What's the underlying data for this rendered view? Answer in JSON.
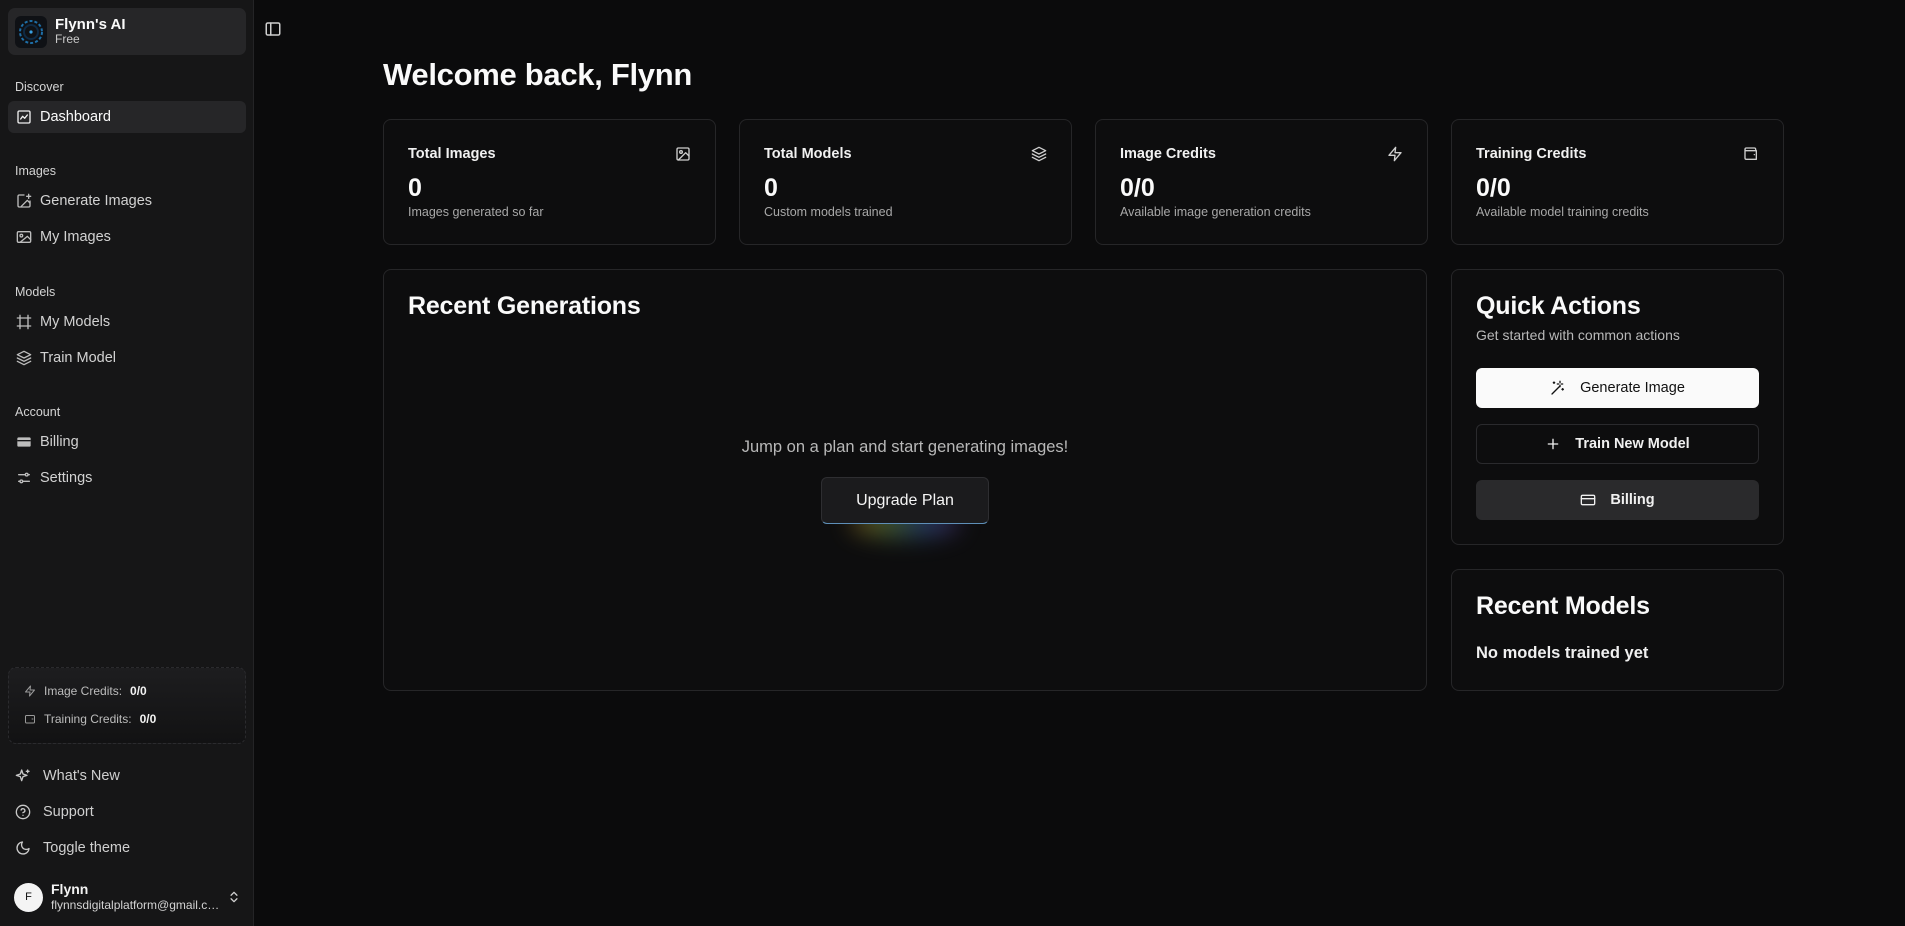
{
  "app": {
    "name": "Flynn's AI",
    "plan": "Free"
  },
  "sidebar": {
    "groups": [
      {
        "label": "Discover",
        "items": [
          {
            "label": "Dashboard",
            "icon": "dashboard-icon",
            "active": true
          }
        ]
      },
      {
        "label": "Images",
        "items": [
          {
            "label": "Generate Images",
            "icon": "image-plus-icon"
          },
          {
            "label": "My Images",
            "icon": "images-icon"
          }
        ]
      },
      {
        "label": "Models",
        "items": [
          {
            "label": "My Models",
            "icon": "frame-icon"
          },
          {
            "label": "Train Model",
            "icon": "layers-icon"
          }
        ]
      },
      {
        "label": "Account",
        "items": [
          {
            "label": "Billing",
            "icon": "credit-card-icon"
          },
          {
            "label": "Settings",
            "icon": "sliders-icon"
          }
        ]
      }
    ],
    "credits": {
      "image_label": "Image Credits:",
      "image_value": "0/0",
      "training_label": "Training Credits:",
      "training_value": "0/0"
    },
    "footer": [
      {
        "label": "What's New",
        "icon": "sparkles-icon"
      },
      {
        "label": "Support",
        "icon": "help-circle-icon"
      },
      {
        "label": "Toggle theme",
        "icon": "moon-icon"
      }
    ],
    "user": {
      "initial": "F",
      "name": "Flynn",
      "email": "flynnsdigitalplatform@gmail.com"
    }
  },
  "main": {
    "title": "Welcome back, Flynn",
    "stats": [
      {
        "title": "Total Images",
        "value": "0",
        "sub": "Images generated so far",
        "icon": "image-icon"
      },
      {
        "title": "Total Models",
        "value": "0",
        "sub": "Custom models trained",
        "icon": "layers-icon"
      },
      {
        "title": "Image Credits",
        "value": "0/0",
        "sub": "Available image generation credits",
        "icon": "zap-icon"
      },
      {
        "title": "Training Credits",
        "value": "0/0",
        "sub": "Available model training credits",
        "icon": "wallet-icon"
      }
    ],
    "recent_generations": {
      "title": "Recent Generations",
      "empty_message": "Jump on a plan and start generating images!",
      "upgrade_label": "Upgrade Plan"
    },
    "quick_actions": {
      "title": "Quick Actions",
      "subtitle": "Get started with common actions",
      "generate_label": "Generate Image",
      "train_label": "Train New Model",
      "billing_label": "Billing"
    },
    "recent_models": {
      "title": "Recent Models",
      "empty_message": "No models trained yet"
    }
  }
}
